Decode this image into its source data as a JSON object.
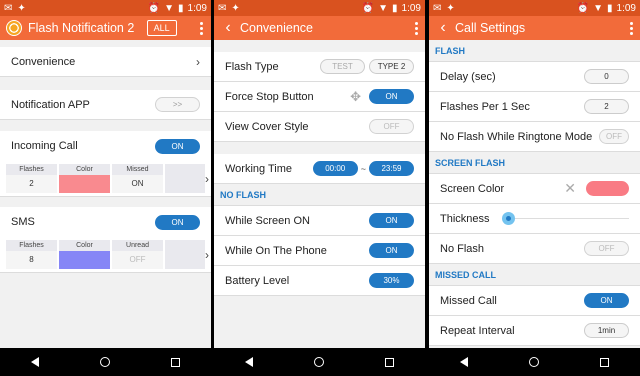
{
  "status": {
    "time": "1:09"
  },
  "screen1": {
    "title": "Flash Notification 2",
    "all_label": "ALL",
    "convenience_label": "Convenience",
    "notification_app_label": "Notification APP",
    "notification_app_button": ">>",
    "incoming_call_label": "Incoming Call",
    "incoming_call_toggle": "ON",
    "incoming_table": {
      "headers": [
        "Flashes",
        "Color",
        "Missed"
      ],
      "values": [
        "2",
        "",
        "ON"
      ],
      "color": "#f98a8f"
    },
    "sms_label": "SMS",
    "sms_toggle": "ON",
    "sms_table": {
      "headers": [
        "Flashes",
        "Color",
        "Unread"
      ],
      "values": [
        "8",
        "",
        "OFF"
      ],
      "color": "#8686f6"
    }
  },
  "screen2": {
    "title": "Convenience",
    "flash_type_label": "Flash Type",
    "flash_type_test": "TEST",
    "flash_type_value": "TYPE 2",
    "force_stop_label": "Force Stop Button",
    "force_stop_toggle": "ON",
    "view_cover_label": "View Cover Style",
    "view_cover_toggle": "OFF",
    "working_time_label": "Working Time",
    "working_time_start": "00:00",
    "working_time_separator": "~",
    "working_time_end": "23:59",
    "no_flash_section": "NO FLASH",
    "screen_on_label": "While Screen ON",
    "screen_on_toggle": "ON",
    "on_phone_label": "While On The Phone",
    "on_phone_toggle": "ON",
    "battery_label": "Battery Level",
    "battery_value": "30%"
  },
  "screen3": {
    "title": "Call Settings",
    "flash_section": "FLASH",
    "delay_label": "Delay (sec)",
    "delay_value": "0",
    "flashes_per_sec_label": "Flashes Per 1 Sec",
    "flashes_per_sec_value": "2",
    "no_flash_ringtone_label": "No Flash While Ringtone Mode",
    "no_flash_ringtone_toggle": "OFF",
    "screen_flash_section": "SCREEN FLASH",
    "screen_color_label": "Screen Color",
    "screen_color_value": "#f97b84",
    "thickness_label": "Thickness",
    "thickness_level": 0,
    "no_flash_label": "No Flash",
    "no_flash_toggle": "OFF",
    "missed_call_section": "MISSED CALL",
    "missed_call_label": "Missed Call",
    "missed_call_toggle": "ON",
    "repeat_interval_label": "Repeat Interval",
    "repeat_interval_value": "1min"
  }
}
